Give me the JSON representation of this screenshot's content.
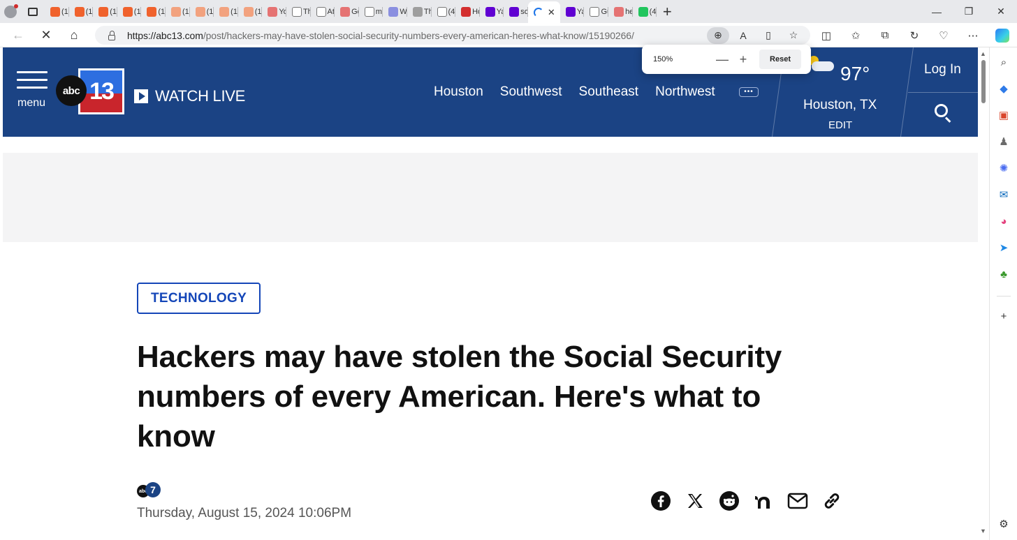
{
  "browser": {
    "tabs": [
      {
        "label": "(1(",
        "favicon_color": "#f0622d"
      },
      {
        "label": "(1(",
        "favicon_color": "#f0622d"
      },
      {
        "label": "(1(",
        "favicon_color": "#f0622d"
      },
      {
        "label": "(1(",
        "favicon_color": "#f0622d"
      },
      {
        "label": "(1(",
        "favicon_color": "#f0622d"
      },
      {
        "label": "(1(",
        "favicon_color": "#f2a27f"
      },
      {
        "label": "(1(",
        "favicon_color": "#f2a27f"
      },
      {
        "label": "(1(",
        "favicon_color": "#f2a27f"
      },
      {
        "label": "(1(",
        "favicon_color": "#f2a27f"
      },
      {
        "label": "Yo",
        "favicon_color": "#e57373"
      },
      {
        "label": "Th",
        "favicon_color": "#ffffff"
      },
      {
        "label": "At",
        "favicon_color": "#ffffff"
      },
      {
        "label": "Go",
        "favicon_color": "#e57373"
      },
      {
        "label": "m",
        "favicon_color": "#ffffff"
      },
      {
        "label": "W",
        "favicon_color": "#8a8fe0"
      },
      {
        "label": "Th",
        "favicon_color": "#9e9e9e"
      },
      {
        "label": "(4",
        "favicon_color": "#ffffff"
      },
      {
        "label": "Ho",
        "favicon_color": "#d32f2f"
      },
      {
        "label": "Ya",
        "favicon_color": "#6001d2"
      },
      {
        "label": "so",
        "favicon_color": "#6001d2"
      }
    ],
    "tabs_after": [
      {
        "label": "Ya",
        "favicon_color": "#6001d2"
      },
      {
        "label": "Gu",
        "favicon_color": "#ffffff"
      },
      {
        "label": "he",
        "favicon_color": "#e57373"
      },
      {
        "label": "(4",
        "favicon_color": "#22c55e"
      }
    ],
    "active_tab_close": "✕",
    "url_host": "https://abc13.com",
    "url_path": "/post/hackers-may-have-stolen-social-security-numbers-every-american-heres-what-know/15190266/",
    "zoom_popup": {
      "level": "150%",
      "minus": "—",
      "plus": "+",
      "reset_label": "Reset"
    }
  },
  "site": {
    "menu_label": "menu",
    "logo_abc": "abc",
    "logo_13": "13",
    "watch_live": "WATCH LIVE",
    "regions": [
      "Houston",
      "Southwest",
      "Southeast",
      "Northwest"
    ],
    "more_dots": "•••",
    "temperature": "97°",
    "location": "Houston, TX",
    "edit_label": "EDIT",
    "login_label": "Log In"
  },
  "article": {
    "category": "TECHNOLOGY",
    "headline": "Hackers may have stolen the Social Security numbers of every American. Here's what to know",
    "byline_logo_abc": "abc",
    "byline_logo_num": "7",
    "date": "Thursday, August 15, 2024 10:06PM"
  },
  "colors": {
    "header_bg": "#1b4384",
    "category_blue": "#1446b8",
    "ad_bg": "#f4f4f5"
  }
}
